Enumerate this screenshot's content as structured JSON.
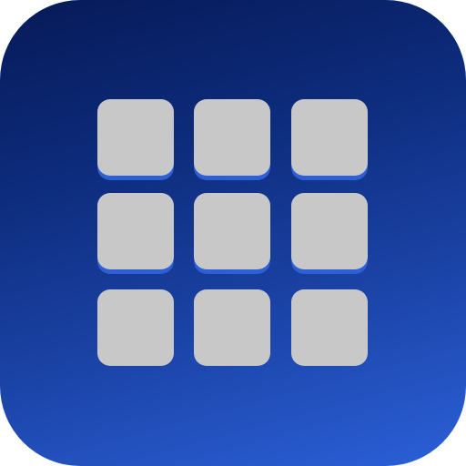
{
  "icon": {
    "name": "grid-app-icon",
    "gradient_colors": [
      "#061a57",
      "#2b60d8"
    ],
    "tile_color": "#c8c8c9",
    "tile_shadow_color": "#2d5fd6"
  },
  "grid": {
    "rows": 3,
    "columns": 3,
    "raised_rows": [
      0,
      1
    ]
  }
}
